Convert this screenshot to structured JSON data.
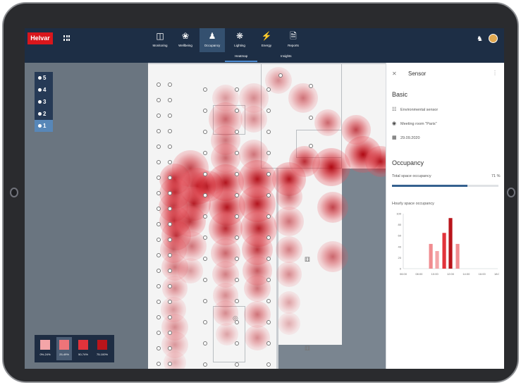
{
  "app": {
    "brand": "Helvar"
  },
  "nav": {
    "tabs": [
      {
        "label": "Monitoring",
        "icon": "monitor-icon"
      },
      {
        "label": "Wellbeing",
        "icon": "leaf-icon"
      },
      {
        "label": "Occupancy",
        "icon": "people-icon",
        "active": true
      },
      {
        "label": "Lighting",
        "icon": "lighting-icon"
      },
      {
        "label": "Energy",
        "icon": "lightning-icon"
      },
      {
        "label": "Reports",
        "icon": "document-icon"
      }
    ],
    "subtabs": [
      {
        "label": "Heatmap",
        "active": true
      },
      {
        "label": "Insights"
      }
    ]
  },
  "floors": [
    "5",
    "4",
    "3",
    "2",
    "1"
  ],
  "active_floor": "1",
  "legend": [
    {
      "label": "0%-24%",
      "color": "#f4a5a8"
    },
    {
      "label": "25-49%",
      "color": "#ee7479"
    },
    {
      "label": "50-74%",
      "color": "#e2333b"
    },
    {
      "label": "75-100%",
      "color": "#b9151b"
    }
  ],
  "panel": {
    "title": "Sensor",
    "basic_heading": "Basic",
    "sensor_type": "Environmental sensor",
    "location": "Meeting room \"Paris\"",
    "date": "29.09.2020",
    "occupancy_heading": "Occupancy",
    "total_label": "Total space occupancy",
    "total_value": "71 %",
    "total_fraction": 0.71,
    "hourly_label": "Hourly space occupancy",
    "accent": "#35618f"
  },
  "chart_data": {
    "type": "bar",
    "y_ticks": [
      "100",
      "80",
      "60",
      "40",
      "20",
      "0"
    ],
    "ylim": [
      0,
      100
    ],
    "x_ticks": [
      "06:00",
      "08:00",
      "10:00",
      "12:00",
      "14:00",
      "16:00",
      "18:00"
    ],
    "bars": [
      {
        "x": 9.5,
        "value": 45,
        "color": "#f08b8f"
      },
      {
        "x": 10.3,
        "value": 32,
        "color": "#f4a5a8"
      },
      {
        "x": 11.2,
        "value": 65,
        "color": "#e2333b"
      },
      {
        "x": 12.0,
        "value": 92,
        "color": "#b9151b"
      },
      {
        "x": 12.9,
        "value": 45,
        "color": "#f08b8f"
      }
    ]
  }
}
